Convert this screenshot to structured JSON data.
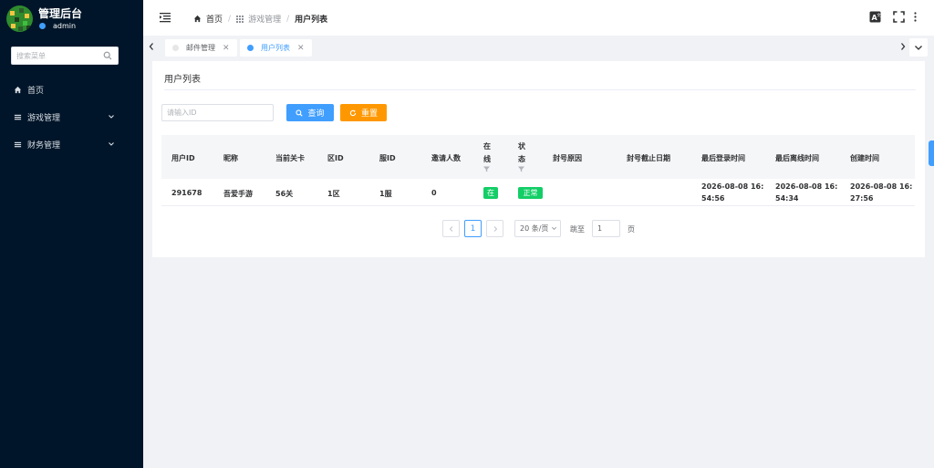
{
  "sidebar": {
    "title": "管理后台",
    "user": "admin",
    "search_placeholder": "搜索菜单",
    "items": [
      {
        "label": "首页",
        "icon": "home-icon"
      },
      {
        "label": "游戏管理",
        "icon": "menu-icon"
      },
      {
        "label": "财务管理",
        "icon": "menu-icon"
      }
    ]
  },
  "header": {
    "breadcrumb": {
      "home": "首页",
      "section": "游戏管理",
      "current": "用户列表"
    }
  },
  "tabs": [
    {
      "label": "邮件管理",
      "active": false
    },
    {
      "label": "用户列表",
      "active": true
    }
  ],
  "page": {
    "title": "用户列表",
    "filter_placeholder": "请输入ID",
    "search_label": "查询",
    "reset_label": "重置"
  },
  "table": {
    "columns": [
      "用户ID",
      "昵称",
      "当前关卡",
      "区ID",
      "服ID",
      "邀请人数",
      "在线",
      "状态",
      "封号原因",
      "封号截止日期",
      "最后登录时间",
      "最后离线时间",
      "创建时间"
    ],
    "rows": [
      {
        "user_id": "291678",
        "nickname": "吾爱手游",
        "level": "56关",
        "zone": "1区",
        "server": "1服",
        "invites": "0",
        "online": "在",
        "status": "正常",
        "ban_reason": "",
        "ban_until": "",
        "last_login_a": "2026-08-08 16:",
        "last_login_b": "54:56",
        "last_offline_a": "2026-08-08 16:",
        "last_offline_b": "54:34",
        "created_a": "2026-08-08 16:",
        "created_b": "27:56"
      }
    ]
  },
  "pagination": {
    "page": "1",
    "page_size": "20 条/页",
    "jump_label": "跳至",
    "jump_value": "1",
    "page_suffix": "页"
  },
  "colors": {
    "sidebar_bg": "#001529",
    "accent": "#409eff",
    "warning": "#ff9800",
    "success": "#13ce66"
  }
}
